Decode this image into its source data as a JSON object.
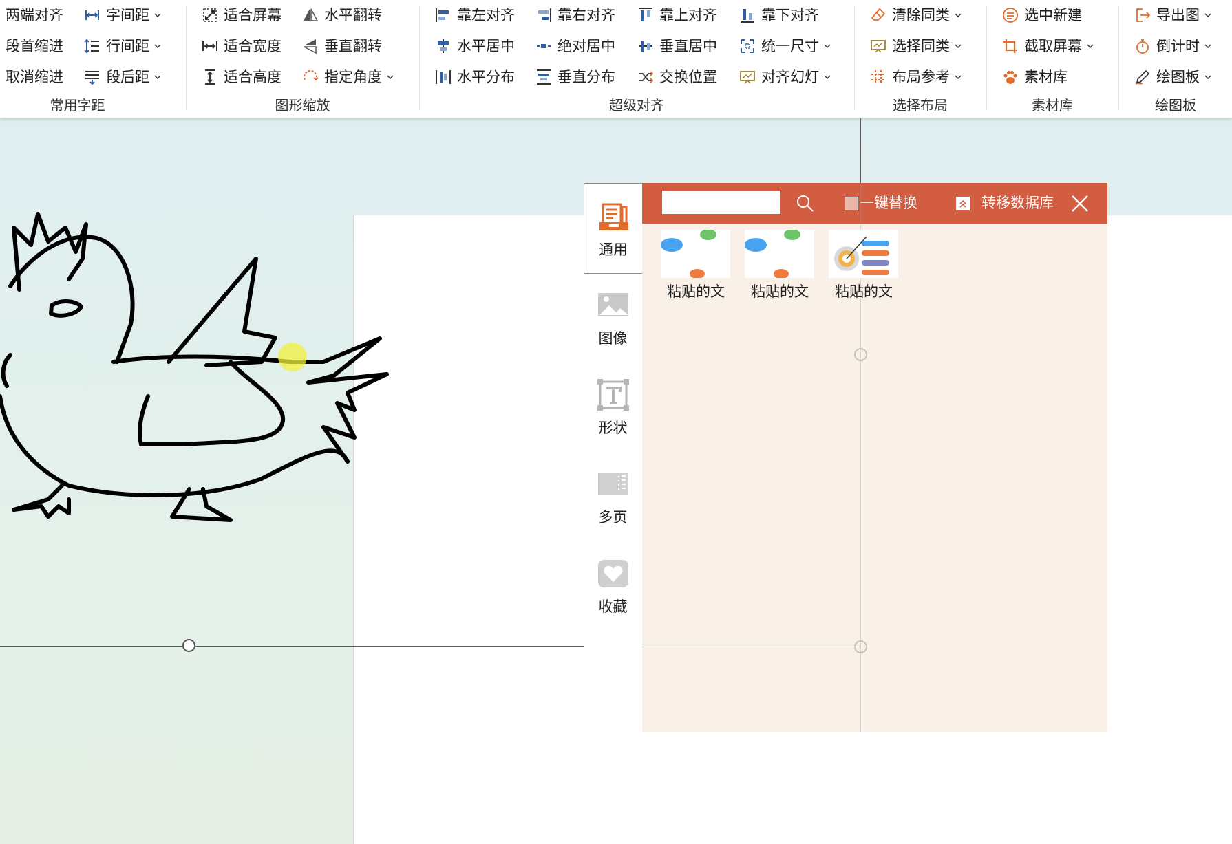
{
  "ribbon": {
    "groups": [
      {
        "title": "常用字距",
        "items": [
          {
            "label": "两端对齐",
            "icon": "justify-icon",
            "dropdown": false
          },
          {
            "label": "字间距",
            "icon": "char-spacing-icon",
            "dropdown": true
          },
          {
            "label": "段首缩进",
            "icon": "indent-icon",
            "dropdown": false
          },
          {
            "label": "行间距",
            "icon": "line-spacing-icon",
            "dropdown": true
          },
          {
            "label": "取消缩进",
            "icon": "outdent-icon",
            "dropdown": false
          },
          {
            "label": "段后距",
            "icon": "para-after-icon",
            "dropdown": true
          }
        ]
      },
      {
        "title": "图形缩放",
        "items": [
          {
            "label": "适合屏幕",
            "icon": "fit-screen-icon",
            "dropdown": false
          },
          {
            "label": "水平翻转",
            "icon": "flip-horizontal-icon",
            "dropdown": false
          },
          {
            "label": "适合宽度",
            "icon": "fit-width-icon",
            "dropdown": false
          },
          {
            "label": "垂直翻转",
            "icon": "flip-vertical-icon",
            "dropdown": false
          },
          {
            "label": "适合高度",
            "icon": "fit-height-icon",
            "dropdown": false
          },
          {
            "label": "指定角度",
            "icon": "rotate-angle-icon",
            "dropdown": true
          }
        ]
      },
      {
        "title": "超级对齐",
        "items": [
          {
            "label": "靠左对齐",
            "icon": "align-left-icon",
            "dropdown": false
          },
          {
            "label": "靠右对齐",
            "icon": "align-right-icon",
            "dropdown": false
          },
          {
            "label": "靠上对齐",
            "icon": "align-top-icon",
            "dropdown": false
          },
          {
            "label": "靠下对齐",
            "icon": "align-bottom-icon",
            "dropdown": false
          },
          {
            "label": "水平居中",
            "icon": "center-horizontal-icon",
            "dropdown": false
          },
          {
            "label": "绝对居中",
            "icon": "absolute-center-icon",
            "dropdown": false
          },
          {
            "label": "垂直居中",
            "icon": "center-vertical-icon",
            "dropdown": false
          },
          {
            "label": "统一尺寸",
            "icon": "uniform-size-icon",
            "dropdown": true
          },
          {
            "label": "水平分布",
            "icon": "distribute-horizontal-icon",
            "dropdown": false
          },
          {
            "label": "垂直分布",
            "icon": "distribute-vertical-icon",
            "dropdown": false
          },
          {
            "label": "交换位置",
            "icon": "swap-icon",
            "dropdown": false
          },
          {
            "label": "对齐幻灯",
            "icon": "align-slide-icon",
            "dropdown": true
          }
        ]
      },
      {
        "title": "选择布局",
        "items": [
          {
            "label": "清除同类",
            "icon": "clear-similar-icon",
            "dropdown": true
          },
          {
            "label": "选择同类",
            "icon": "select-similar-icon",
            "dropdown": true
          },
          {
            "label": "布局参考",
            "icon": "layout-guide-icon",
            "dropdown": true
          }
        ]
      },
      {
        "title": "素材库",
        "items": [
          {
            "label": "选中新建",
            "icon": "new-from-selection-icon",
            "dropdown": false
          },
          {
            "label": "截取屏幕",
            "icon": "crop-screen-icon",
            "dropdown": true
          },
          {
            "label": "素材库",
            "icon": "paw-icon",
            "dropdown": false
          }
        ]
      },
      {
        "title": "绘图板",
        "items": [
          {
            "label": "导出图",
            "icon": "export-icon",
            "dropdown": true
          },
          {
            "label": "倒计时",
            "icon": "stopwatch-icon",
            "dropdown": true
          },
          {
            "label": "绘图板",
            "icon": "pen-icon",
            "dropdown": true
          }
        ]
      }
    ]
  },
  "panel": {
    "search_value": "",
    "replace_label": "一键替换",
    "transfer_label": "转移数据库",
    "tabs": [
      {
        "label": "通用",
        "icon": "general-icon",
        "active": true
      },
      {
        "label": "图像",
        "icon": "image-icon",
        "active": false
      },
      {
        "label": "形状",
        "icon": "shape-icon",
        "active": false
      },
      {
        "label": "多页",
        "icon": "multipage-icon",
        "active": false
      },
      {
        "label": "收藏",
        "icon": "favorite-icon",
        "active": false
      }
    ],
    "items": [
      {
        "label": "粘贴的文"
      },
      {
        "label": "粘贴的文"
      },
      {
        "label": "粘贴的文"
      }
    ]
  },
  "colors": {
    "accent": "#d35d41",
    "panel_bg": "#f9f0e7",
    "icon_orange": "#e36c2b",
    "icon_blue": "#2f5f9e"
  }
}
